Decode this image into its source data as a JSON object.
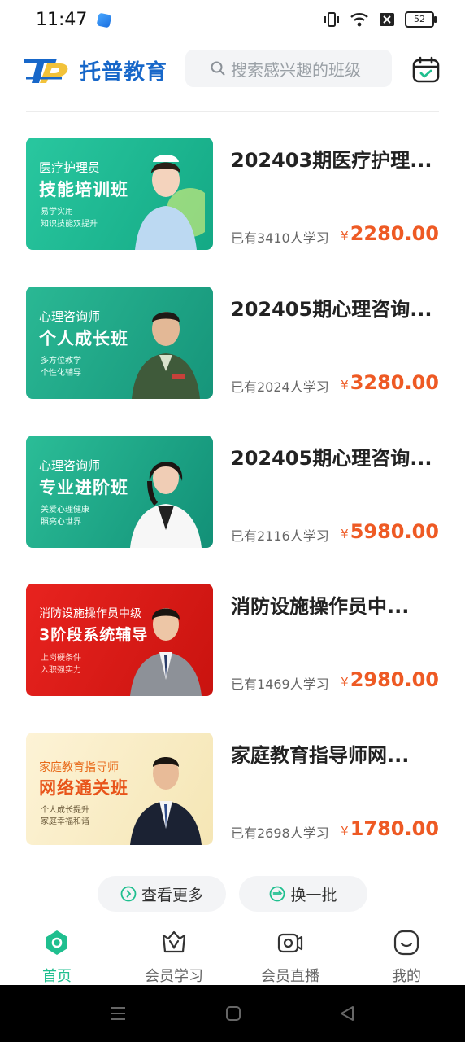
{
  "status": {
    "time": "11:47",
    "battery": "52"
  },
  "header": {
    "brand_mark": "TP",
    "brand_name": "托普教育",
    "search_placeholder": "搜索感兴趣的班级"
  },
  "courses": [
    {
      "title": "202403期医疗护理...",
      "learners": "已有3410人学习",
      "currency": "¥",
      "price": "2280.00",
      "thumb": {
        "line1": "医疗护理员",
        "line2": "技能培训班",
        "bullet1": "易学实用",
        "bullet2": "知识技能双提升"
      }
    },
    {
      "title": "202405期心理咨询...",
      "learners": "已有2024人学习",
      "currency": "¥",
      "price": "3280.00",
      "thumb": {
        "line1": "心理咨询师",
        "line2": "个人成长班",
        "bullet1": "多方位教学",
        "bullet2": "个性化辅导"
      }
    },
    {
      "title": "202405期心理咨询...",
      "learners": "已有2116人学习",
      "currency": "¥",
      "price": "5980.00",
      "thumb": {
        "line1": "心理咨询师",
        "line2": "专业进阶班",
        "bullet1": "关爱心理健康",
        "bullet2": "照亮心世界"
      }
    },
    {
      "title": "消防设施操作员中...",
      "learners": "已有1469人学习",
      "currency": "¥",
      "price": "2980.00",
      "thumb": {
        "line1": "消防设施操作员中级",
        "line2": "3阶段系统辅导",
        "bullet1": "上岗硬条件",
        "bullet2": "入职强实力"
      }
    },
    {
      "title": "家庭教育指导师网...",
      "learners": "已有2698人学习",
      "currency": "¥",
      "price": "1780.00",
      "thumb": {
        "line1": "家庭教育指导师",
        "line2": "网络通关班",
        "bullet1": "个人成长提升",
        "bullet2": "家庭幸福和谐"
      }
    }
  ],
  "actions": {
    "more": "查看更多",
    "refresh": "换一批"
  },
  "tabs": [
    {
      "label": "首页",
      "icon": "home-icon"
    },
    {
      "label": "会员学习",
      "icon": "vip-learn-icon"
    },
    {
      "label": "会员直播",
      "icon": "live-camera-icon"
    },
    {
      "label": "我的",
      "icon": "profile-icon"
    }
  ],
  "colors": {
    "accent": "#1fbf8f",
    "price": "#ee5a24",
    "brand": "#1767c9"
  }
}
